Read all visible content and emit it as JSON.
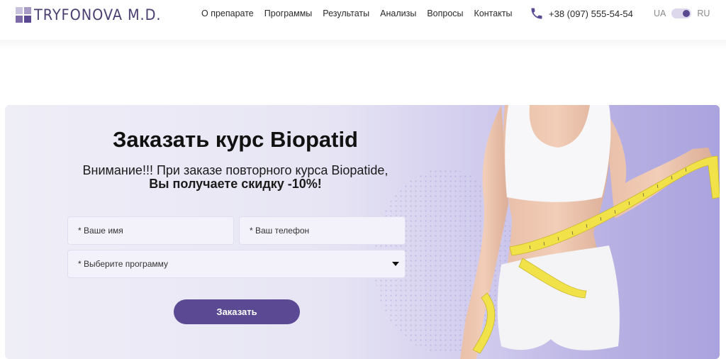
{
  "header": {
    "logo_text": "TRYFONOVA M.D.",
    "nav": [
      "О препарате",
      "Программы",
      "Результаты",
      "Анализы",
      "Вопросы",
      "Контакты"
    ],
    "phone": "+38 (097) 555-54-54",
    "lang": {
      "left": "UA",
      "right": "RU",
      "selected": "RU"
    }
  },
  "order": {
    "title": "Заказать курс Biopatid",
    "subtitle": "Внимание!!! При заказе повторного курса Biopatide,",
    "subtitle_bold": "Вы получаете скидку -10%!",
    "name_placeholder": "* Ваше имя",
    "phone_placeholder": "* Ваш телефон",
    "program_placeholder": "* Выберите программу",
    "submit_label": "Заказать"
  },
  "colors": {
    "brand": "#5b4a93",
    "banner_light": "#efeef7",
    "banner_dark": "#aaa3de",
    "tape": "#f2e24a"
  },
  "icons": [
    "phone-icon",
    "chevron-down-icon"
  ]
}
